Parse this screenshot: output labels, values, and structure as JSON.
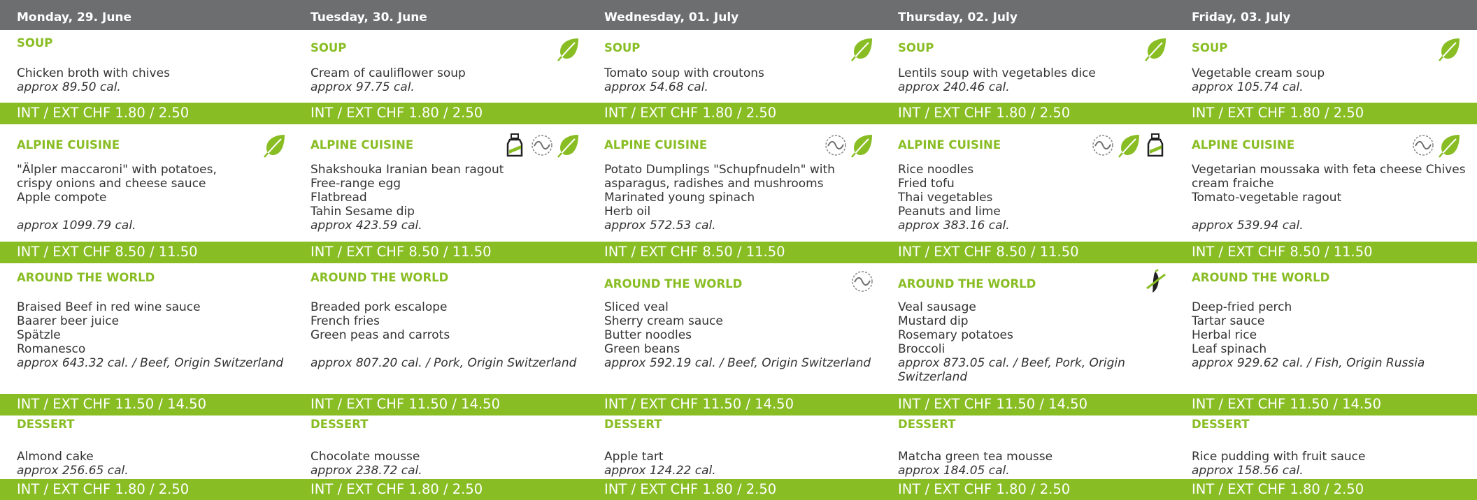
{
  "days": [
    {
      "date": "Monday, 29. June",
      "menus": [
        {
          "category": "SOUP",
          "icons": [],
          "lines": [
            "Chicken broth with chives"
          ],
          "cal": "approx 89.50 cal."
        },
        {
          "category": "ALPINE CUISINE",
          "icons": [
            "leaf-icon"
          ],
          "lines": [
            "\"Älpler maccaroni\" with potatoes,",
            "crispy onions and cheese sauce",
            "Apple compote",
            ""
          ],
          "cal": "approx 1099.79 cal."
        },
        {
          "category": "AROUND THE WORLD",
          "icons": [],
          "lines": [
            "Braised Beef in red wine sauce",
            "Baarer beer juice",
            "Spätzle",
            "Romanesco"
          ],
          "cal": "approx 643.32 cal. / Beef, Origin Switzerland"
        },
        {
          "category": "DESSERT",
          "icons": [],
          "lines": [
            "Almond cake"
          ],
          "cal": "approx 256.65 cal."
        }
      ]
    },
    {
      "date": "Tuesday, 30. June",
      "menus": [
        {
          "category": "SOUP",
          "icons": [
            "leaf-icon"
          ],
          "lines": [
            "Cream of cauliflower soup"
          ],
          "cal": "approx 97.75 cal."
        },
        {
          "category": "ALPINE CUISINE",
          "icons": [
            "bottle-icon",
            "wave-icon",
            "leaf-icon"
          ],
          "lines": [
            "Shakshouka Iranian bean ragout",
            "Free-range egg",
            "Flatbread",
            "Tahin Sesame dip"
          ],
          "cal": "approx 423.59 cal."
        },
        {
          "category": "AROUND THE WORLD",
          "icons": [],
          "lines": [
            "Breaded pork escalope",
            "French fries",
            "Green peas and carrots",
            ""
          ],
          "cal": "approx 807.20 cal. / Pork, Origin Switzerland"
        },
        {
          "category": "DESSERT",
          "icons": [],
          "lines": [
            "Chocolate mousse"
          ],
          "cal": "approx 238.72 cal."
        }
      ]
    },
    {
      "date": "Wednesday, 01. July",
      "menus": [
        {
          "category": "SOUP",
          "icons": [
            "leaf-icon"
          ],
          "lines": [
            "Tomato soup with croutons"
          ],
          "cal": "approx 54.68 cal."
        },
        {
          "category": "ALPINE CUISINE",
          "icons": [
            "wave-icon",
            "leaf-icon"
          ],
          "lines": [
            "Potato Dumplings \"Schupfnudeln\" with",
            "asparagus, radishes and mushrooms",
            "Marinated young spinach",
            "Herb oil"
          ],
          "cal": "approx 572.53 cal."
        },
        {
          "category": "AROUND THE WORLD",
          "icons": [
            "wave-icon"
          ],
          "lines": [
            "Sliced veal",
            "Sherry cream sauce",
            "Butter noodles",
            "Green beans"
          ],
          "cal": "approx 592.19 cal. / Beef, Origin Switzerland"
        },
        {
          "category": "DESSERT",
          "icons": [],
          "lines": [
            "Apple tart"
          ],
          "cal": "approx 124.22 cal."
        }
      ]
    },
    {
      "date": "Thursday, 02. July",
      "menus": [
        {
          "category": "SOUP",
          "icons": [
            "leaf-icon"
          ],
          "lines": [
            "Lentils soup with vegetables dice"
          ],
          "cal": "approx 240.46 cal."
        },
        {
          "category": "ALPINE CUISINE",
          "icons": [
            "wave-icon",
            "leaf-icon",
            "bottle-icon"
          ],
          "lines": [
            "Rice noodles",
            "Fried tofu",
            "Thai vegetables",
            "Peanuts and lime"
          ],
          "cal": "approx 383.16 cal."
        },
        {
          "category": "AROUND THE WORLD",
          "icons": [
            "chili-icon"
          ],
          "lines": [
            "Veal sausage",
            "Mustard dip",
            "Rosemary potatoes",
            "Broccoli"
          ],
          "cal": "approx 873.05 cal. / Beef, Pork, Origin Switzerland"
        },
        {
          "category": "DESSERT",
          "icons": [],
          "lines": [
            "Matcha green tea mousse"
          ],
          "cal": "approx 184.05 cal."
        }
      ]
    },
    {
      "date": "Friday, 03. July",
      "menus": [
        {
          "category": "SOUP",
          "icons": [
            "leaf-icon"
          ],
          "lines": [
            "Vegetable cream soup"
          ],
          "cal": "approx 105.74 cal."
        },
        {
          "category": "ALPINE CUISINE",
          "icons": [
            "wave-icon",
            "leaf-icon"
          ],
          "lines": [
            "Vegetarian moussaka with feta cheese Chives",
            "cream fraiche",
            "Tomato-vegetable ragout",
            ""
          ],
          "cal": "approx 539.94 cal."
        },
        {
          "category": "AROUND THE WORLD",
          "icons": [],
          "lines": [
            "Deep-fried perch",
            "Tartar sauce",
            "Herbal rice",
            "Leaf spinach"
          ],
          "cal": "approx 929.62 cal. / Fish, Origin Russia"
        },
        {
          "category": "DESSERT",
          "icons": [],
          "lines": [
            "Rice pudding with fruit sauce"
          ],
          "cal": "approx 158.56 cal."
        }
      ]
    }
  ],
  "prices": [
    "INT / EXT CHF 1.80 / 2.50",
    "INT / EXT CHF 8.50 / 11.50",
    "INT / EXT CHF 11.50 / 14.50",
    "INT / EXT CHF 1.80 / 2.50"
  ],
  "colors": {
    "header": "#6d6e70",
    "accent": "#89bd24",
    "text": "#333333"
  }
}
